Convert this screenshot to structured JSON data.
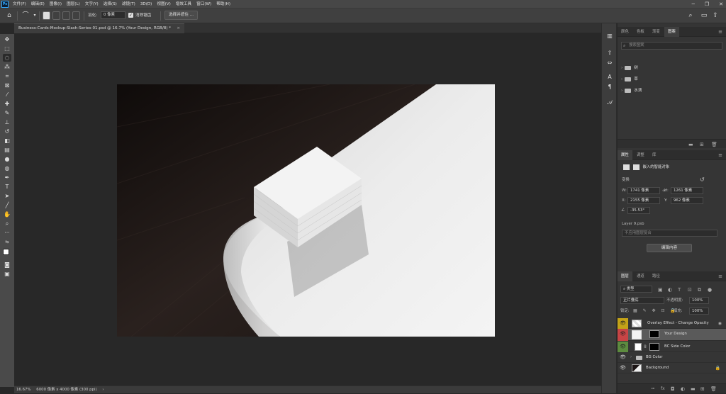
{
  "menubar": {
    "logo": "Ps",
    "items": [
      "文件(F)",
      "编辑(E)",
      "图像(I)",
      "图层(L)",
      "文字(Y)",
      "选择(S)",
      "滤镜(T)",
      "3D(D)",
      "视图(V)",
      "增效工具",
      "窗口(W)",
      "帮助(H)"
    ],
    "window_controls": [
      "─",
      "❐",
      "✕"
    ]
  },
  "options_bar": {
    "feather_label": "羽化:",
    "feather_value": "0 像素",
    "antialias_checked": "✓",
    "antialias_label": "消除锯齿",
    "select_mask_button": "选择并遮住 ..."
  },
  "document": {
    "tab_title": "Business-Cards-Mockup-Slash-Series-01.psd @ 16.7% (Your Design, RGB/8) *",
    "close": "×"
  },
  "status": {
    "zoom": "16.67%",
    "size": "6000 像素 x 4000 像素 (300 ppi)",
    "arrow": "›"
  },
  "toolbar_tools": [
    "move-icon",
    "marquee-icon",
    "lasso-icon",
    "magic-wand-icon",
    "crop-icon",
    "frame-icon",
    "eyedropper-icon",
    "healing-icon",
    "brush-icon",
    "stamp-icon",
    "history-brush-icon",
    "eraser-icon",
    "gradient-icon",
    "blur-icon",
    "dodge-icon",
    "pen-icon",
    "type-icon",
    "path-select-icon",
    "shape-icon",
    "hand-icon",
    "zoom-icon",
    "more-icon",
    "swap-colors-icon",
    "foreground-color",
    "quick-mask-icon",
    "screen-mode-icon"
  ],
  "swatches_panel": {
    "tabs": [
      "颜色",
      "色板",
      "渐变",
      "图案"
    ],
    "active_tab": 3,
    "search_placeholder": "搜索图案",
    "groups": [
      "树",
      "草",
      "水滴"
    ]
  },
  "properties_panel": {
    "tabs": [
      "属性",
      "调整",
      "库"
    ],
    "object_type": "嵌入的智能对象",
    "transform_label": "变换",
    "w_label": "W:",
    "w_value": "1741 像素",
    "h_label": "H:",
    "h_value": "1261 像素",
    "x_label": "X:",
    "x_value": "2155 像素",
    "y_label": "Y:",
    "y_value": "962 像素",
    "angle_value": "-35.53°",
    "file_name": "Layer 9.psb",
    "comp_placeholder": "不应用图层复合",
    "edit_button": "编辑内容"
  },
  "layers_panel": {
    "tabs": [
      "图层",
      "通道",
      "路径"
    ],
    "filter_kind": "类型",
    "blend_mode": "正片叠底",
    "opacity_label": "不透明度:",
    "opacity_value": "100%",
    "lock_label": "锁定:",
    "fill_label": "填充:",
    "fill_value": "100%",
    "layers": [
      {
        "name": "Overlay Effect - Change Opacity",
        "eye_color": "#c4a318"
      },
      {
        "name": "Your Design",
        "eye_color": "#c74445"
      },
      {
        "name": "BC Side Color",
        "eye_color": "#5d8b3f"
      },
      {
        "name": "BG Color",
        "eye_color": ""
      },
      {
        "name": "Background",
        "eye_color": ""
      }
    ]
  },
  "colors": {
    "accent": "#31a8ff",
    "yellow": "#c4a318",
    "red": "#c74445",
    "green": "#5d8b3f"
  }
}
